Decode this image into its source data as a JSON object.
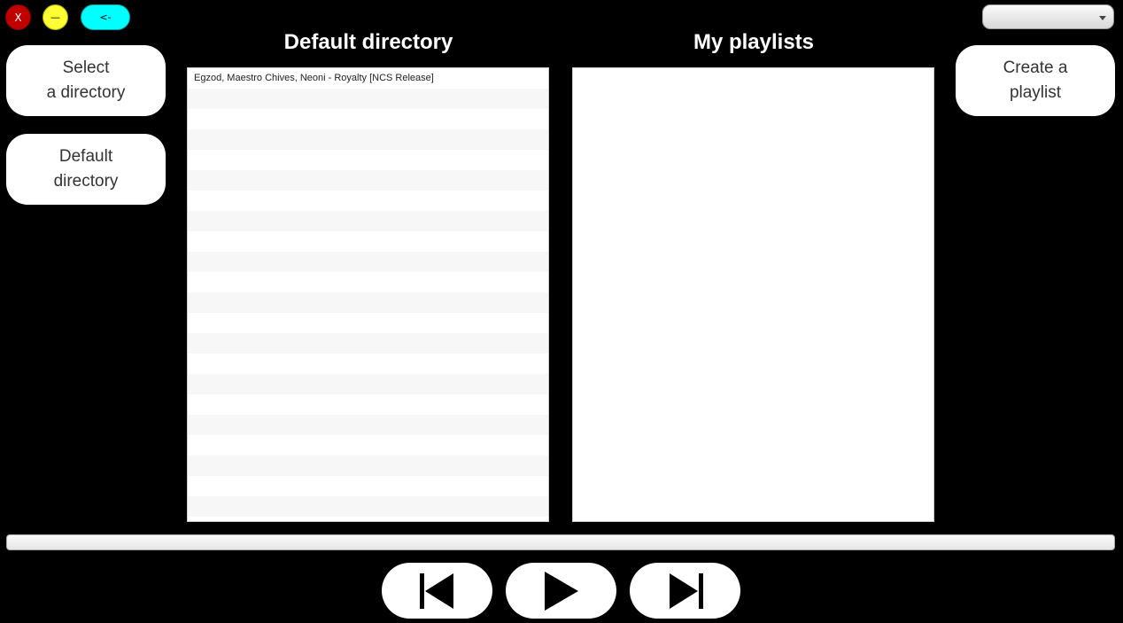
{
  "window_controls": {
    "close_label": "X",
    "minimize_label": "—",
    "back_label": "<-"
  },
  "dropdown": {
    "selected": ""
  },
  "buttons": {
    "select_directory": "Select\na directory",
    "default_directory": "Default\ndirectory",
    "create_playlist": "Create a\nplaylist"
  },
  "headings": {
    "default_directory": "Default directory",
    "my_playlists": "My playlists"
  },
  "default_directory_list": {
    "items": [
      "Egzod, Maestro Chives, Neoni - Royalty [NCS Release]"
    ]
  },
  "playlists_list": {
    "items": []
  },
  "colors": {
    "background": "#000000",
    "close": "#c00000",
    "minimize": "#ffff33",
    "back": "#00ffff"
  },
  "icons": {
    "previous": "skip-previous-icon",
    "play": "play-icon",
    "next": "skip-next-icon"
  }
}
